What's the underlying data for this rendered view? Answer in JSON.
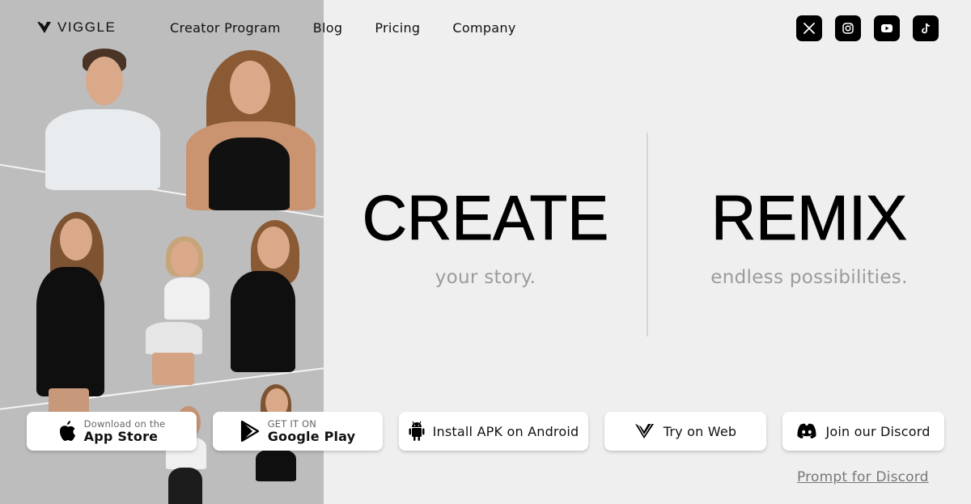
{
  "header": {
    "logo_text": "VIGGLE",
    "nav": [
      {
        "label": "Creator Program"
      },
      {
        "label": "Blog"
      },
      {
        "label": "Pricing"
      },
      {
        "label": "Company"
      }
    ],
    "socials": [
      {
        "name": "x-icon",
        "label": "X"
      },
      {
        "name": "instagram-icon",
        "label": "Instagram"
      },
      {
        "name": "youtube-icon",
        "label": "YouTube"
      },
      {
        "name": "tiktok-icon",
        "label": "TikTok"
      }
    ]
  },
  "hero": {
    "left": {
      "title": "CREATE",
      "subtitle": "your story."
    },
    "right": {
      "title": "REMIX",
      "subtitle": "endless possibilities."
    }
  },
  "buttons": {
    "app_store": {
      "small": "Download on the",
      "large": "App Store",
      "icon": "apple-icon"
    },
    "google_play": {
      "small": "GET IT ON",
      "large": "Google Play",
      "icon": "google-play-icon"
    },
    "apk": {
      "label": "Install APK on Android",
      "icon": "android-icon"
    },
    "web": {
      "label": "Try on Web",
      "icon": "viggle-logo-icon"
    },
    "discord": {
      "label": "Join our Discord",
      "icon": "discord-icon"
    }
  },
  "links": {
    "prompt_discord": "Prompt for Discord"
  },
  "colors": {
    "background": "#efefef",
    "photo_panel": "#bdbdbd",
    "subtitle": "#9b9b9b",
    "button_bg": "#ffffff",
    "social_bg": "#000000"
  }
}
